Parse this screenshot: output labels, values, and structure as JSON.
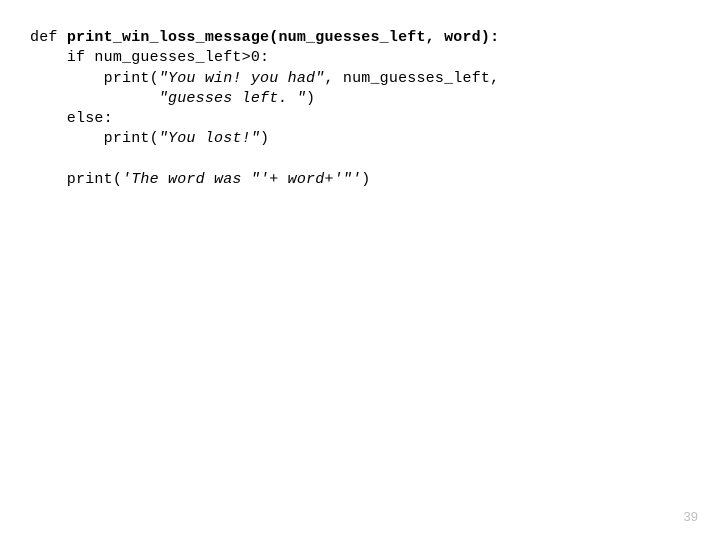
{
  "code": {
    "l1_def": "def ",
    "l1_fn": "print_win_loss_message(num_guesses_left, word):",
    "l2": "    if num_guesses_left>0:",
    "l3a": "        print(",
    "l3s": "\"You win! you had\"",
    "l3b": ", num_guesses_left,",
    "l4s": "              \"guesses left. \"",
    "l4b": ")",
    "l5": "    else:",
    "l6a": "        print(",
    "l6s": "\"You lost!\"",
    "l6b": ")",
    "l8a": "    print(",
    "l8s": "'The word was \"'+ word+'\"'",
    "l8b": ")"
  },
  "page_number": "39"
}
